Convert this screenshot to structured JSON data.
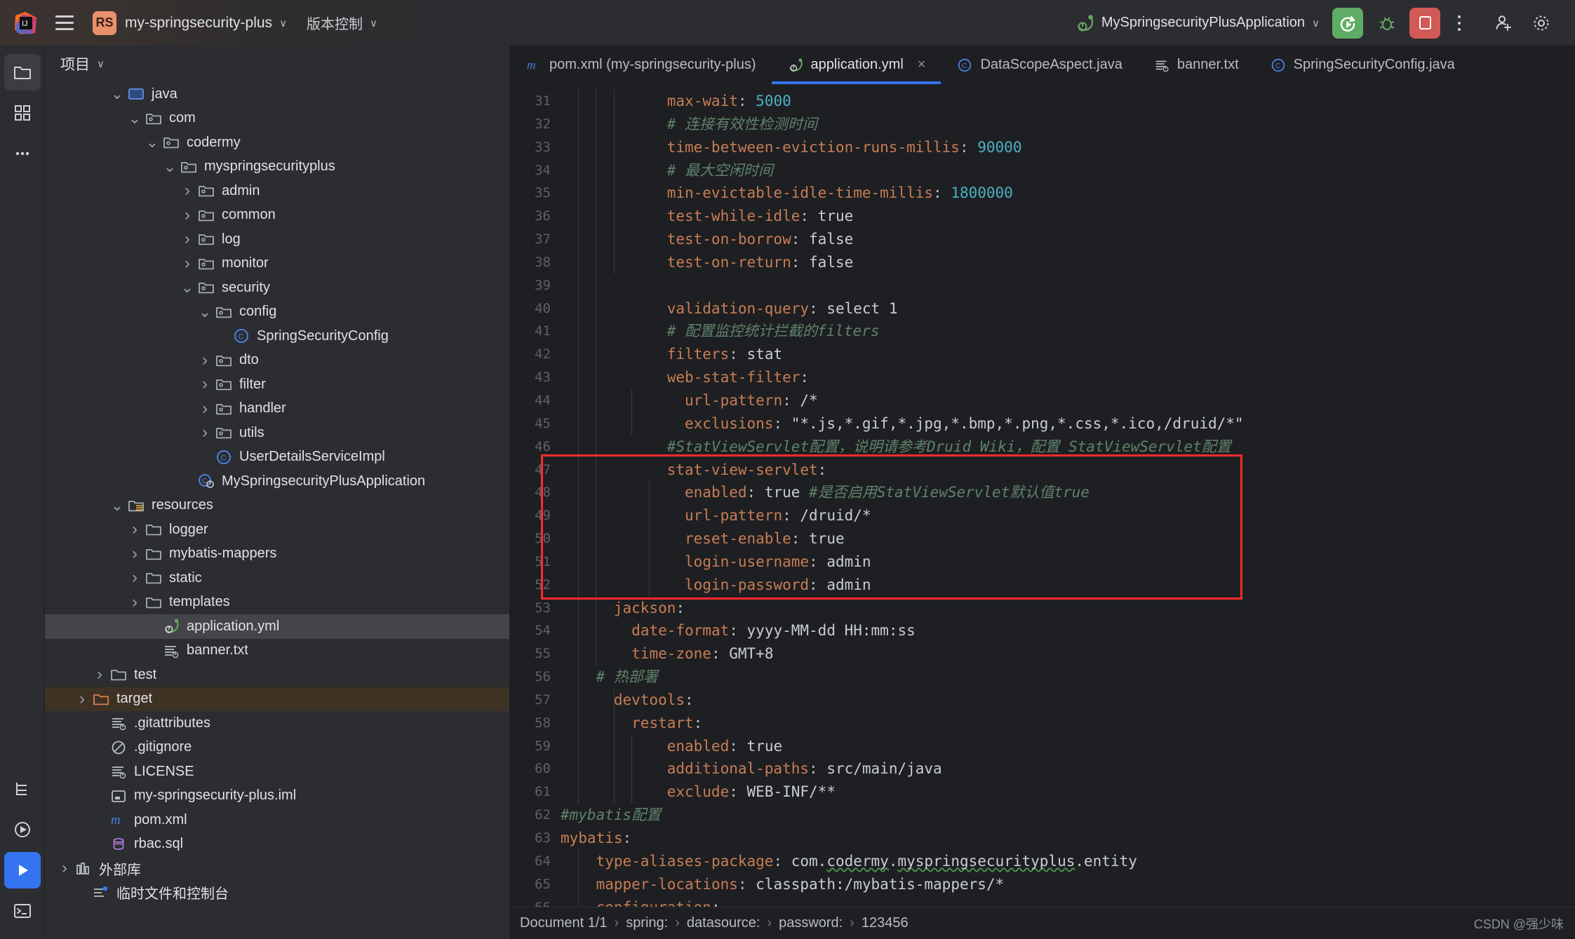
{
  "titlebar": {
    "app_icon": "intellij-idea-logo",
    "menu_icon": "hamburger-menu-icon",
    "project_badge": "RS",
    "project_name": "my-springsecurity-plus",
    "project_chevron": "∨",
    "vcs_label": "版本控制",
    "vcs_chevron": "∨",
    "run_config": "MySpringsecurityPlusApplication",
    "run_config_chevron": "∨",
    "run_button": "run-with-coverage-button",
    "debug_button": "debug-button",
    "stop_button": "stop-button",
    "more_button": "more-actions-button",
    "account_button": "account-icon",
    "settings_button": "settings-icon"
  },
  "rail": {
    "items": [
      {
        "name": "project-tool-window",
        "icon": "folder-icon",
        "active": true
      },
      {
        "name": "commit-tool-window",
        "icon": "grid-icon",
        "active": false
      },
      {
        "name": "more-tool-windows",
        "icon": "ellipsis-icon",
        "active": false
      }
    ],
    "bottom": [
      {
        "name": "structure-tool-window",
        "icon": "structure-icon"
      },
      {
        "name": "run-tool-window",
        "icon": "play-circle-icon"
      },
      {
        "name": "run-button-rail",
        "icon": "play-icon"
      },
      {
        "name": "terminal-tool-window",
        "icon": "terminal-icon"
      }
    ]
  },
  "project_panel": {
    "title": "项目",
    "title_chevron": "∨",
    "tree": [
      {
        "label": "java",
        "indent": 4,
        "twist": "down",
        "icon": "source-root-icon",
        "state": "normal"
      },
      {
        "label": "com",
        "indent": 5,
        "twist": "down",
        "icon": "package-icon",
        "state": "normal"
      },
      {
        "label": "codermy",
        "indent": 6,
        "twist": "down",
        "icon": "package-icon",
        "state": "normal"
      },
      {
        "label": "myspringsecurityplus",
        "indent": 7,
        "twist": "down",
        "icon": "package-icon",
        "state": "normal"
      },
      {
        "label": "admin",
        "indent": 8,
        "twist": "right",
        "icon": "package-icon",
        "state": "normal"
      },
      {
        "label": "common",
        "indent": 8,
        "twist": "right",
        "icon": "package-icon",
        "state": "normal"
      },
      {
        "label": "log",
        "indent": 8,
        "twist": "right",
        "icon": "package-icon",
        "state": "normal"
      },
      {
        "label": "monitor",
        "indent": 8,
        "twist": "right",
        "icon": "package-icon",
        "state": "normal"
      },
      {
        "label": "security",
        "indent": 8,
        "twist": "down",
        "icon": "package-icon",
        "state": "normal"
      },
      {
        "label": "config",
        "indent": 9,
        "twist": "down",
        "icon": "package-icon",
        "state": "normal"
      },
      {
        "label": "SpringSecurityConfig",
        "indent": 10,
        "twist": "none",
        "icon": "java-class-icon",
        "state": "normal"
      },
      {
        "label": "dto",
        "indent": 9,
        "twist": "right",
        "icon": "package-icon",
        "state": "normal"
      },
      {
        "label": "filter",
        "indent": 9,
        "twist": "right",
        "icon": "package-icon",
        "state": "normal"
      },
      {
        "label": "handler",
        "indent": 9,
        "twist": "right",
        "icon": "package-icon",
        "state": "normal"
      },
      {
        "label": "utils",
        "indent": 9,
        "twist": "right",
        "icon": "package-icon",
        "state": "normal"
      },
      {
        "label": "UserDetailsServiceImpl",
        "indent": 9,
        "twist": "none",
        "icon": "java-class-icon",
        "state": "normal"
      },
      {
        "label": "MySpringsecurityPlusApplication",
        "indent": 8,
        "twist": "none",
        "icon": "spring-boot-class-icon",
        "state": "normal"
      },
      {
        "label": "resources",
        "indent": 4,
        "twist": "down",
        "icon": "resource-root-icon",
        "state": "normal"
      },
      {
        "label": "logger",
        "indent": 5,
        "twist": "right",
        "icon": "folder-icon",
        "state": "normal"
      },
      {
        "label": "mybatis-mappers",
        "indent": 5,
        "twist": "right",
        "icon": "folder-icon",
        "state": "normal"
      },
      {
        "label": "static",
        "indent": 5,
        "twist": "right",
        "icon": "folder-icon",
        "state": "normal"
      },
      {
        "label": "templates",
        "indent": 5,
        "twist": "right",
        "icon": "folder-icon",
        "state": "normal"
      },
      {
        "label": "application.yml",
        "indent": 6,
        "twist": "none",
        "icon": "spring-yaml-icon",
        "state": "selected"
      },
      {
        "label": "banner.txt",
        "indent": 6,
        "twist": "none",
        "icon": "text-file-icon",
        "state": "normal"
      },
      {
        "label": "test",
        "indent": 3,
        "twist": "right",
        "icon": "folder-icon",
        "state": "normal"
      },
      {
        "label": "target",
        "indent": 2,
        "twist": "right",
        "icon": "excluded-folder-icon",
        "state": "target"
      },
      {
        "label": ".gitattributes",
        "indent": 3,
        "twist": "none",
        "icon": "text-file-icon",
        "state": "normal"
      },
      {
        "label": ".gitignore",
        "indent": 3,
        "twist": "none",
        "icon": "ignored-file-icon",
        "state": "normal"
      },
      {
        "label": "LICENSE",
        "indent": 3,
        "twist": "none",
        "icon": "text-file-icon",
        "state": "normal"
      },
      {
        "label": "my-springsecurity-plus.iml",
        "indent": 3,
        "twist": "none",
        "icon": "iml-file-icon",
        "state": "normal"
      },
      {
        "label": "pom.xml",
        "indent": 3,
        "twist": "none",
        "icon": "maven-file-icon",
        "state": "normal"
      },
      {
        "label": "rbac.sql",
        "indent": 3,
        "twist": "none",
        "icon": "sql-file-icon",
        "state": "normal"
      },
      {
        "label": "外部库",
        "indent": 1,
        "twist": "right",
        "icon": "library-icon",
        "state": "normal"
      },
      {
        "label": "临时文件和控制台",
        "indent": 2,
        "twist": "none",
        "icon": "scratches-icon",
        "state": "normal"
      }
    ]
  },
  "tabs": [
    {
      "label": "pom.xml (my-springsecurity-plus)",
      "icon": "maven-file-icon",
      "active": false,
      "closeable": false
    },
    {
      "label": "application.yml",
      "icon": "spring-yaml-icon",
      "active": true,
      "closeable": true,
      "close_glyph": "×"
    },
    {
      "label": "DataScopeAspect.java",
      "icon": "java-class-icon",
      "active": false,
      "closeable": false
    },
    {
      "label": "banner.txt",
      "icon": "text-file-icon",
      "active": false,
      "closeable": false
    },
    {
      "label": "SpringSecurityConfig.java",
      "icon": "java-class-icon",
      "active": false,
      "closeable": false
    }
  ],
  "editor": {
    "first_line_number": 31,
    "lines": [
      {
        "n": 31,
        "indent": 6,
        "tokens": [
          {
            "t": "max-wait",
            "c": "k"
          },
          {
            "t": ": ",
            "c": "pn"
          },
          {
            "t": "5000",
            "c": "num"
          }
        ]
      },
      {
        "n": 32,
        "indent": 6,
        "tokens": [
          {
            "t": "# 连接有效性检测时间",
            "c": "cm"
          }
        ]
      },
      {
        "n": 33,
        "indent": 6,
        "tokens": [
          {
            "t": "time-between-eviction-runs-millis",
            "c": "k"
          },
          {
            "t": ": ",
            "c": "pn"
          },
          {
            "t": "90000",
            "c": "num"
          }
        ]
      },
      {
        "n": 34,
        "indent": 6,
        "tokens": [
          {
            "t": "# 最大空闲时间",
            "c": "cm"
          }
        ]
      },
      {
        "n": 35,
        "indent": 6,
        "tokens": [
          {
            "t": "min-evictable-idle-time-millis",
            "c": "k"
          },
          {
            "t": ": ",
            "c": "pn"
          },
          {
            "t": "1800000",
            "c": "num"
          }
        ]
      },
      {
        "n": 36,
        "indent": 6,
        "tokens": [
          {
            "t": "test-while-idle",
            "c": "k"
          },
          {
            "t": ": ",
            "c": "pn"
          },
          {
            "t": "true",
            "c": "str"
          }
        ]
      },
      {
        "n": 37,
        "indent": 6,
        "tokens": [
          {
            "t": "test-on-borrow",
            "c": "k"
          },
          {
            "t": ": ",
            "c": "pn"
          },
          {
            "t": "false",
            "c": "str"
          }
        ]
      },
      {
        "n": 38,
        "indent": 6,
        "tokens": [
          {
            "t": "test-on-return",
            "c": "k"
          },
          {
            "t": ": ",
            "c": "pn"
          },
          {
            "t": "false",
            "c": "str"
          }
        ]
      },
      {
        "n": 39,
        "indent": 0,
        "tokens": []
      },
      {
        "n": 40,
        "indent": 6,
        "tokens": [
          {
            "t": "validation-query",
            "c": "k"
          },
          {
            "t": ": ",
            "c": "pn"
          },
          {
            "t": "select 1",
            "c": "str"
          }
        ]
      },
      {
        "n": 41,
        "indent": 6,
        "tokens": [
          {
            "t": "# 配置监控统计拦截的filters",
            "c": "cm"
          }
        ]
      },
      {
        "n": 42,
        "indent": 6,
        "tokens": [
          {
            "t": "filters",
            "c": "k"
          },
          {
            "t": ": ",
            "c": "pn"
          },
          {
            "t": "stat",
            "c": "str"
          }
        ]
      },
      {
        "n": 43,
        "indent": 6,
        "tokens": [
          {
            "t": "web-stat-filter",
            "c": "k"
          },
          {
            "t": ":",
            "c": "pn"
          }
        ]
      },
      {
        "n": 44,
        "indent": 7,
        "tokens": [
          {
            "t": "url-pattern",
            "c": "k"
          },
          {
            "t": ": ",
            "c": "pn"
          },
          {
            "t": "/*",
            "c": "str"
          }
        ]
      },
      {
        "n": 45,
        "indent": 7,
        "tokens": [
          {
            "t": "exclusions",
            "c": "k"
          },
          {
            "t": ": ",
            "c": "pn"
          },
          {
            "t": "\"*.js,*.gif,*.jpg,*.bmp,*.png,*.css,*.ico,/druid/*\"",
            "c": "str"
          }
        ]
      },
      {
        "n": 46,
        "indent": 6,
        "tokens": [
          {
            "t": "#StatViewServlet配置，说明请参考Druid Wiki，配置_StatViewServlet配置",
            "c": "cm"
          }
        ]
      },
      {
        "n": 47,
        "indent": 6,
        "tokens": [
          {
            "t": "stat-view-servlet",
            "c": "k"
          },
          {
            "t": ":",
            "c": "pn"
          }
        ]
      },
      {
        "n": 48,
        "indent": 7,
        "tokens": [
          {
            "t": "enabled",
            "c": "k"
          },
          {
            "t": ": ",
            "c": "pn"
          },
          {
            "t": "true ",
            "c": "str"
          },
          {
            "t": "#是否启用StatViewServlet默认值true",
            "c": "cm"
          }
        ]
      },
      {
        "n": 49,
        "indent": 7,
        "tokens": [
          {
            "t": "url-pattern",
            "c": "k"
          },
          {
            "t": ": ",
            "c": "pn"
          },
          {
            "t": "/druid/*",
            "c": "str"
          }
        ]
      },
      {
        "n": 50,
        "indent": 7,
        "tokens": [
          {
            "t": "reset-enable",
            "c": "k"
          },
          {
            "t": ": ",
            "c": "pn"
          },
          {
            "t": "true",
            "c": "str"
          }
        ]
      },
      {
        "n": 51,
        "indent": 7,
        "tokens": [
          {
            "t": "login-username",
            "c": "k"
          },
          {
            "t": ": ",
            "c": "pn"
          },
          {
            "t": "admin",
            "c": "str"
          }
        ]
      },
      {
        "n": 52,
        "indent": 7,
        "tokens": [
          {
            "t": "login-password",
            "c": "k"
          },
          {
            "t": ": ",
            "c": "pn"
          },
          {
            "t": "admin",
            "c": "str"
          }
        ]
      },
      {
        "n": 53,
        "indent": 3,
        "tokens": [
          {
            "t": "jackson",
            "c": "k"
          },
          {
            "t": ":",
            "c": "pn"
          }
        ]
      },
      {
        "n": 54,
        "indent": 4,
        "tokens": [
          {
            "t": "date-format",
            "c": "k"
          },
          {
            "t": ": ",
            "c": "pn"
          },
          {
            "t": "yyyy-MM-dd HH:mm:ss",
            "c": "str"
          }
        ]
      },
      {
        "n": 55,
        "indent": 4,
        "tokens": [
          {
            "t": "time-zone",
            "c": "k"
          },
          {
            "t": ": ",
            "c": "pn"
          },
          {
            "t": "GMT+8",
            "c": "str"
          }
        ]
      },
      {
        "n": 56,
        "indent": 2,
        "tokens": [
          {
            "t": "# 热部署",
            "c": "cm"
          }
        ]
      },
      {
        "n": 57,
        "indent": 3,
        "tokens": [
          {
            "t": "devtools",
            "c": "k"
          },
          {
            "t": ":",
            "c": "pn"
          }
        ]
      },
      {
        "n": 58,
        "indent": 4,
        "tokens": [
          {
            "t": "restart",
            "c": "k"
          },
          {
            "t": ":",
            "c": "pn"
          }
        ]
      },
      {
        "n": 59,
        "indent": 6,
        "tokens": [
          {
            "t": "enabled",
            "c": "k"
          },
          {
            "t": ": ",
            "c": "pn"
          },
          {
            "t": "true",
            "c": "str"
          }
        ]
      },
      {
        "n": 60,
        "indent": 6,
        "tokens": [
          {
            "t": "additional-paths",
            "c": "k"
          },
          {
            "t": ": ",
            "c": "pn"
          },
          {
            "t": "src/main/java",
            "c": "str"
          }
        ]
      },
      {
        "n": 61,
        "indent": 6,
        "tokens": [
          {
            "t": "exclude",
            "c": "k"
          },
          {
            "t": ": ",
            "c": "pn"
          },
          {
            "t": "WEB-INF/**",
            "c": "str"
          }
        ]
      },
      {
        "n": 62,
        "indent": 0,
        "tokens": [
          {
            "t": "#mybatis配置",
            "c": "cm"
          }
        ]
      },
      {
        "n": 63,
        "indent": 0,
        "tokens": [
          {
            "t": "mybatis",
            "c": "k"
          },
          {
            "t": ":",
            "c": "pn"
          }
        ]
      },
      {
        "n": 64,
        "indent": 2,
        "tokens": [
          {
            "t": "type-aliases-package",
            "c": "k"
          },
          {
            "t": ": ",
            "c": "pn"
          },
          {
            "t": "com.",
            "c": "str"
          },
          {
            "t": "codermy",
            "c": "str wavy"
          },
          {
            "t": ".",
            "c": "str"
          },
          {
            "t": "myspringsecurityplus",
            "c": "str wavy"
          },
          {
            "t": ".entity",
            "c": "str"
          }
        ]
      },
      {
        "n": 65,
        "indent": 2,
        "tokens": [
          {
            "t": "mapper-locations",
            "c": "k"
          },
          {
            "t": ": ",
            "c": "pn"
          },
          {
            "t": "classpath:/mybatis-mappers/*",
            "c": "str"
          }
        ]
      },
      {
        "n": 66,
        "indent": 2,
        "tokens": [
          {
            "t": "configuration",
            "c": "k"
          },
          {
            "t": ":",
            "c": "pn"
          }
        ]
      }
    ],
    "highlight_box": {
      "from_line": 47,
      "to_line": 52,
      "color": "#ff2b2b"
    }
  },
  "status_bar": {
    "breadcrumb": [
      "Document 1/1",
      "spring:",
      "datasource:",
      "password:",
      "123456"
    ],
    "separator": "›",
    "watermark": "CSDN @强少味"
  }
}
